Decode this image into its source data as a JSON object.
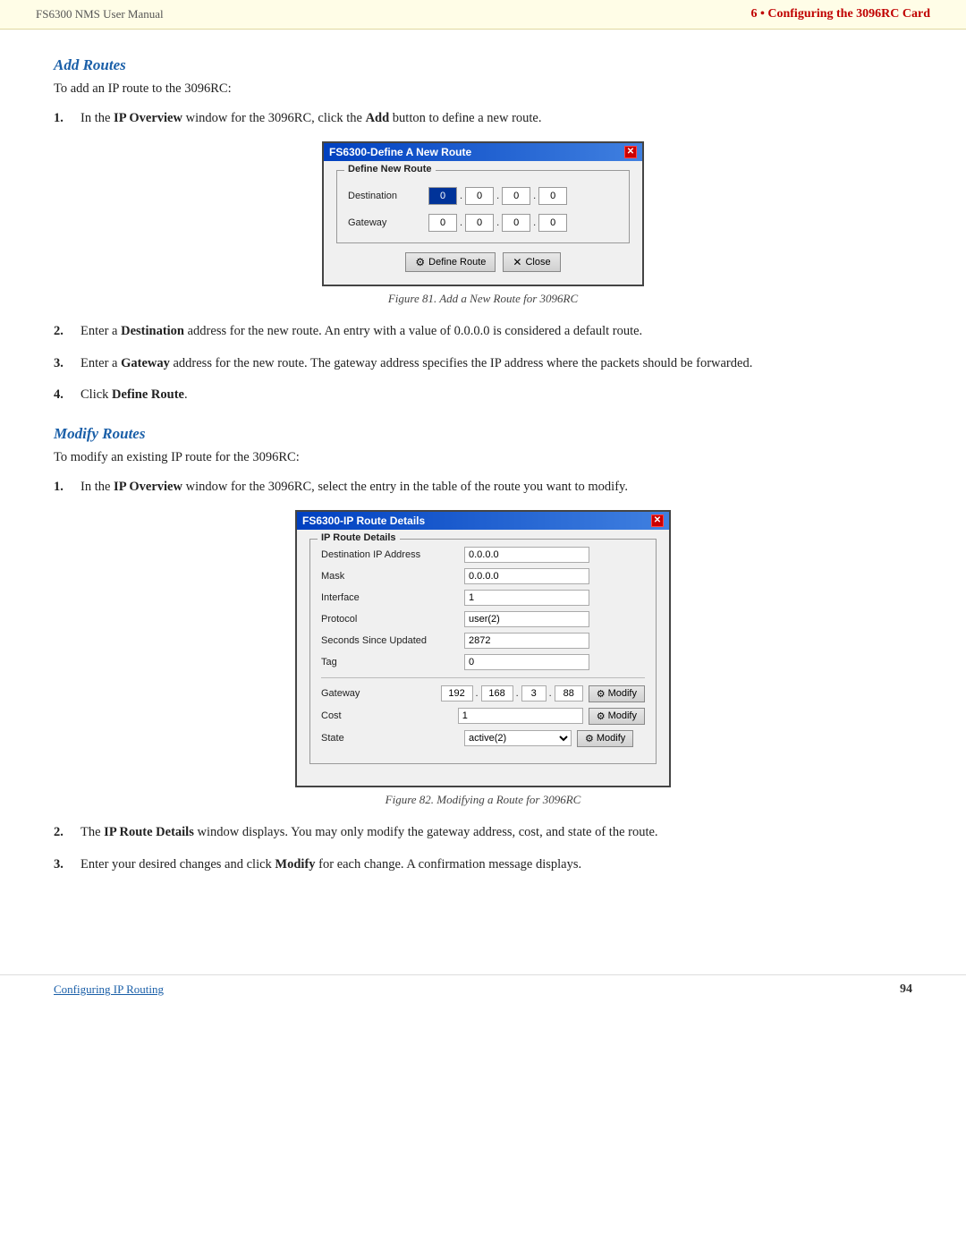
{
  "header": {
    "left": "FS6300 NMS User Manual",
    "right": "6 • Configuring the 3096RC Card"
  },
  "add_routes": {
    "heading": "Add Routes",
    "intro": "To add an IP route to the 3096RC:",
    "step1": {
      "num": "1.",
      "text_before_bold": "In the ",
      "bold1": "IP Overview",
      "text_after_bold1": " window for the 3096RC, click the ",
      "bold2": "Add",
      "text_after_bold2": " button to define a new route."
    },
    "dialog1": {
      "title": "FS6300-Define A New Route",
      "close_label": "✕",
      "group_title": "Define New Route",
      "dest_label": "Destination",
      "dest_octets": [
        "0",
        "0",
        "0",
        "0"
      ],
      "gw_label": "Gateway",
      "gw_octets": [
        "0",
        "0",
        "0",
        "0"
      ],
      "btn_define": "Define Route",
      "btn_close": "Close",
      "btn_define_icon": "⚙",
      "btn_close_icon": "✕"
    },
    "figure1_caption": "Figure 81. Add a New Route for 3096RC",
    "step2": {
      "num": "2.",
      "bold": "Destination",
      "text": " address for the new route. An entry with a value of 0.0.0.0 is considered a default route."
    },
    "step3": {
      "num": "3.",
      "bold": "Gateway",
      "text": " address for the new route. The gateway address specifies the IP address where the packets should be forwarded."
    },
    "step4": {
      "num": "4.",
      "text_before": "Click ",
      "bold": "Define Route",
      "text_after": "."
    }
  },
  "modify_routes": {
    "heading": "Modify Routes",
    "intro": "To modify an existing IP route for the 3096RC:",
    "step1": {
      "num": "1.",
      "text_before_bold": "In the ",
      "bold1": "IP Overview",
      "text_after_bold1": " window for the 3096RC, select the entry in the table of the route you want to modify."
    },
    "dialog2": {
      "title": "FS6300-IP Route Details",
      "close_label": "✕",
      "group_title": "IP Route Details",
      "fields": [
        {
          "label": "Destination IP Address",
          "value": "0.0.0.0",
          "has_btn": false
        },
        {
          "label": "Mask",
          "value": "0.0.0.0",
          "has_btn": false
        },
        {
          "label": "Interface",
          "value": "1",
          "has_btn": false
        },
        {
          "label": "Protocol",
          "value": "user(2)",
          "has_btn": false
        },
        {
          "label": "Seconds Since Updated",
          "value": "2872",
          "has_btn": false
        },
        {
          "label": "Tag",
          "value": "0",
          "has_btn": false
        }
      ],
      "gateway_label": "Gateway",
      "gateway_octets": [
        "192",
        "168",
        "3",
        "88"
      ],
      "gateway_btn": "Modify",
      "cost_label": "Cost",
      "cost_value": "1",
      "cost_btn": "Modify",
      "state_label": "State",
      "state_value": "active(2)",
      "state_btn": "Modify",
      "modify_icon": "⚙"
    },
    "figure2_caption": "Figure 82. Modifying a Route for 3096RC",
    "step2": {
      "num": "2.",
      "bold": "IP Route Details",
      "text": " window displays. You may only modify the gateway address, cost, and state of the route."
    },
    "step3": {
      "num": "3.",
      "text": "Enter your desired changes and click ",
      "bold": "Modify",
      "text_after": " for each change. A confirmation message displays."
    }
  },
  "footer": {
    "left": "Configuring IP Routing",
    "right": "94"
  }
}
